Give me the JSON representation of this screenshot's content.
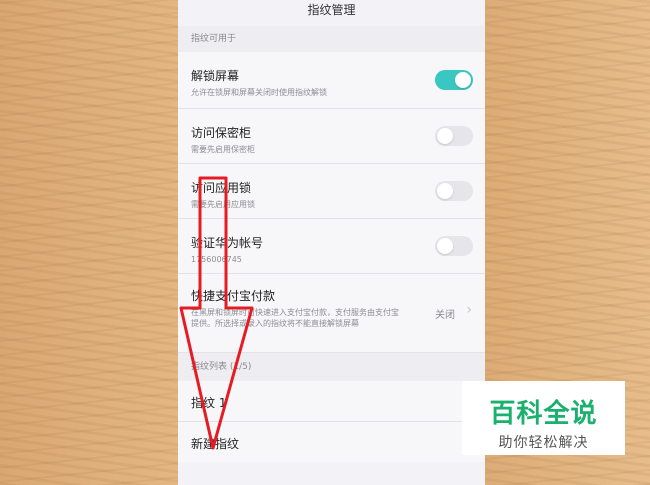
{
  "topbar": {
    "title": "指纹管理"
  },
  "sections": {
    "usage_header": "指纹可用于",
    "list_header": "指纹列表 (1/5)"
  },
  "rows": [
    {
      "title": "解锁屏幕",
      "subtitle": "允许在锁屏和屏幕关闭时使用指纹解锁",
      "toggle": true
    },
    {
      "title": "访问保密柜",
      "subtitle": "需要先启用保密柜",
      "toggle": false
    },
    {
      "title": "访问应用锁",
      "subtitle": "需要先启用应用锁",
      "toggle": false
    },
    {
      "title": "验证华为帐号",
      "subtitle": "1756006745",
      "toggle": false
    },
    {
      "title": "快捷支付宝付款",
      "subtitle": "在黑屏和锁屏时可快速进入支付宝付款，支付服务由支付宝提供。所选择或录入的指纹将不能直接解锁屏幕",
      "value": "关闭"
    }
  ],
  "fingerprints": {
    "item1": "指纹 1",
    "new": "新建指纹"
  },
  "brand": {
    "title": "百科全说",
    "subtitle": "助你轻松解决"
  },
  "colors": {
    "accent": "#3bc7c1",
    "arrow": "#e51c23",
    "brand": "#1ab06e"
  }
}
